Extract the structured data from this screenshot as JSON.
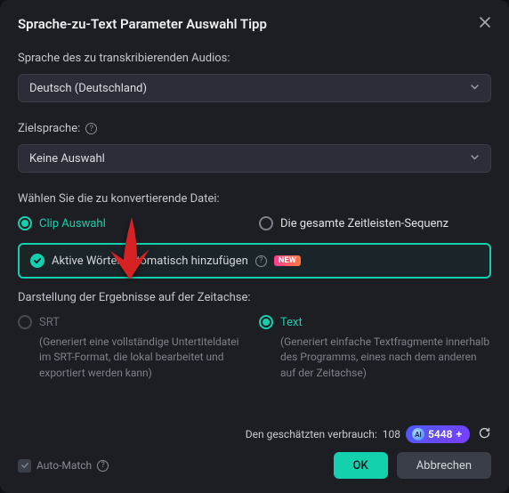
{
  "title": "Sprache-zu-Text Parameter Auswahl Tipp",
  "source_label": "Sprache des zu transkribierenden Audios:",
  "source_value": "Deutsch (Deutschland)",
  "target_label": "Zielsprache:",
  "target_value": "Keine Auswahl",
  "file_label": "Wählen Sie die zu konvertierende Datei:",
  "file_options": {
    "clip": "Clip Auswahl",
    "timeline": "Die gesamte Zeitleisten-Sequenz"
  },
  "active_words": {
    "label": "Aktive Wörter automatisch hinzufügen",
    "badge": "NEW"
  },
  "results_label": "Darstellung der Ergebnisse auf der Zeitachse:",
  "results_options": {
    "srt": {
      "label": "SRT",
      "desc": "(Generiert eine vollständige Untertiteldatei im SRT-Format, die lokal bearbeitet und exportiert werden kann)"
    },
    "text": {
      "label": "Text",
      "desc": "(Generiert einfache Textfragmente innerhalb des Programms, eines nach dem anderen auf der Zeitachse)"
    }
  },
  "footer": {
    "usage_label": "Den geschätzten verbrauch:",
    "usage_value": "108",
    "credits": "5448",
    "auto_match": "Auto-Match",
    "ok": "OK",
    "cancel": "Abbrechen"
  }
}
